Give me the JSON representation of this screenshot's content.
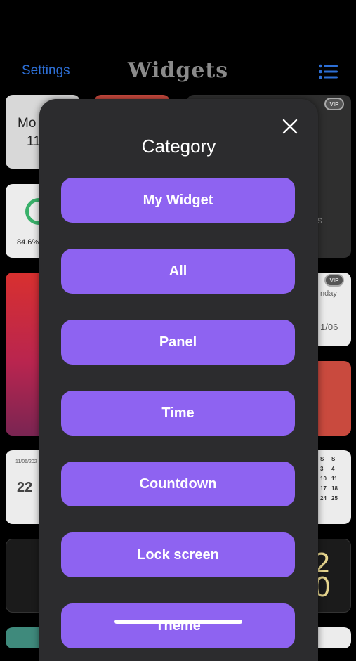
{
  "nav": {
    "left_label": "Settings",
    "title": "Widgets",
    "right_icon": "list-icon"
  },
  "background_tiles": {
    "vip_label": "VIP",
    "tile1_line1": "Mo",
    "tile1_line2": "11",
    "tile2_percent": "84.6%",
    "tile3_fragment": "s",
    "tile4_fragment1": "nday",
    "tile4_fragment2": "1/06",
    "tile5_date": "11/06/202",
    "tile5_day": "22",
    "calendar_header": [
      "S",
      "S"
    ],
    "calendar_rows": [
      [
        "3",
        "4"
      ],
      [
        "10",
        "11"
      ],
      [
        "17",
        "18"
      ],
      [
        "24",
        "25"
      ]
    ],
    "clock_digits": [
      "2",
      "0"
    ]
  },
  "modal": {
    "title": "Category",
    "close_icon": "close-icon",
    "button_color": "#8e63f1",
    "categories": [
      "My Widget",
      "All",
      "Panel",
      "Time",
      "Countdown",
      "Lock screen",
      "Theme"
    ]
  },
  "colors": {
    "accent_blue": "#2d6fd6",
    "modal_bg": "#2c2c2e"
  }
}
